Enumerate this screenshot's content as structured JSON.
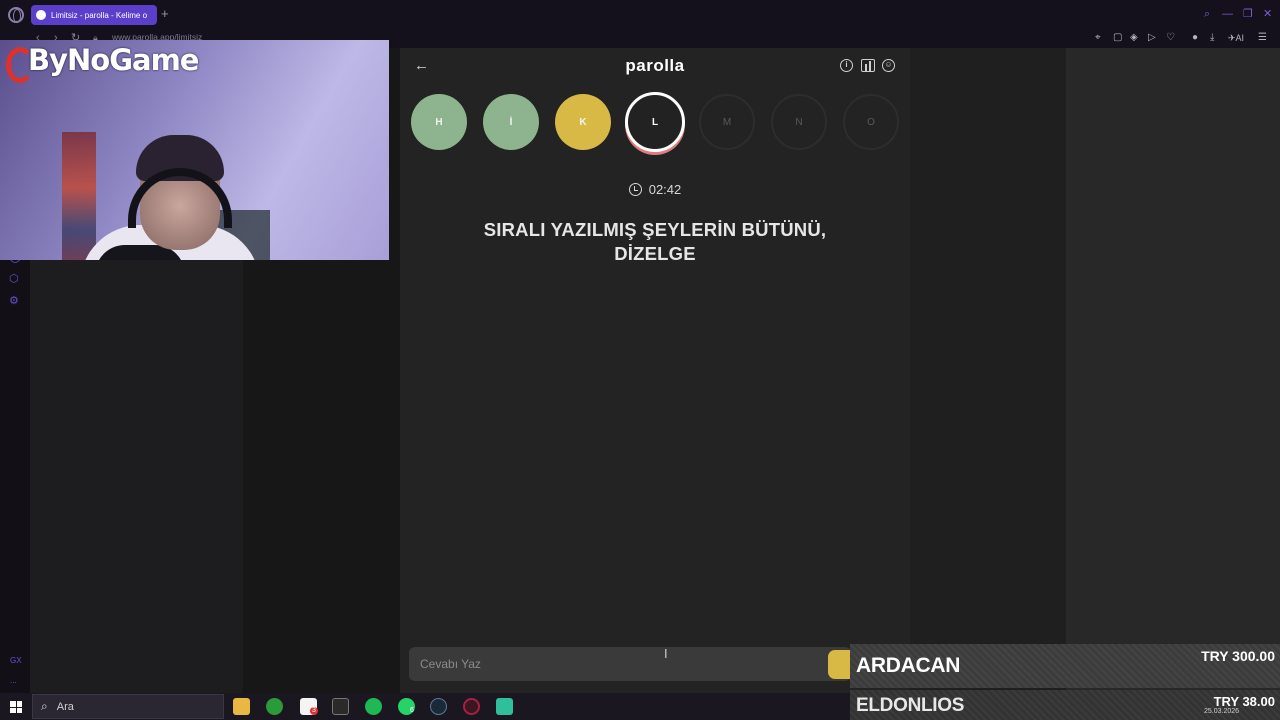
{
  "browser": {
    "tab_title": "Limitsiz - parolla - Kelime o",
    "url": "www.parolla.app/limitsiz",
    "new_tab_label": "+"
  },
  "overlay": {
    "brand": "ByNoGame"
  },
  "app": {
    "title": "parolla",
    "letters": [
      {
        "char": "H",
        "state": "correct"
      },
      {
        "char": "İ",
        "state": "correct"
      },
      {
        "char": "K",
        "state": "pass"
      },
      {
        "char": "L",
        "state": "active"
      },
      {
        "char": "M",
        "state": "pending"
      },
      {
        "char": "N",
        "state": "pending"
      },
      {
        "char": "O",
        "state": "pending"
      }
    ],
    "timer": "02:42",
    "question_line1": "SIRALI YAZILMIŞ ŞEYLERİN BÜTÜNÜ,",
    "question_line2": "DİZELGE",
    "answer_placeholder": "Cevabı Yaz",
    "colors": {
      "correct": "#8db48e",
      "pass": "#d9b945",
      "active_ring": "#e07c7c"
    }
  },
  "donations": [
    {
      "name": "ARDACAN",
      "amount": "TRY 300.00"
    },
    {
      "name": "ELDONLIOS",
      "amount": "TRY 38.00"
    }
  ],
  "taskbar": {
    "search_placeholder": "Ara",
    "badges": {
      "whatsapp": "6",
      "files": "3"
    },
    "date": "25.03.2026"
  },
  "sidebar": {
    "bottom_label": "GX",
    "more_label": "..."
  }
}
